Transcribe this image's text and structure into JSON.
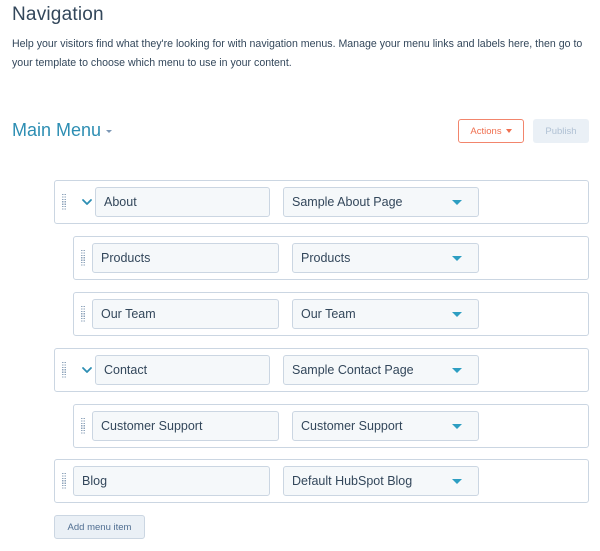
{
  "header": {
    "title": "Navigation",
    "description": "Help your visitors find what they're looking for with navigation menus. Manage your menu links and labels here, then go to your template to choose which menu to use in your content."
  },
  "menu_selector": {
    "current_menu": "Main Menu",
    "icon": "caret-down-icon"
  },
  "toolbar": {
    "actions_label": "Actions",
    "publish_label": "Publish",
    "publish_disabled": true
  },
  "menu_items": [
    {
      "label": "About",
      "page": "Sample About Page",
      "level": 0,
      "expanded": true
    },
    {
      "label": "Products",
      "page": "Products",
      "level": 1
    },
    {
      "label": "Our Team",
      "page": "Our Team",
      "level": 1
    },
    {
      "label": "Contact",
      "page": "Sample Contact Page",
      "level": 0,
      "expanded": true
    },
    {
      "label": "Customer Support",
      "page": "Customer Support",
      "level": 1
    },
    {
      "label": "Blog",
      "page": "Default HubSpot Blog",
      "level": 0
    }
  ],
  "footer": {
    "add_item_label": "Add menu item"
  },
  "colors": {
    "accent_teal": "#2d8eb3",
    "actions_orange": "#f06f4f",
    "border": "#cbd6e2",
    "input_bg": "#f5f8fa",
    "text": "#33475b"
  }
}
